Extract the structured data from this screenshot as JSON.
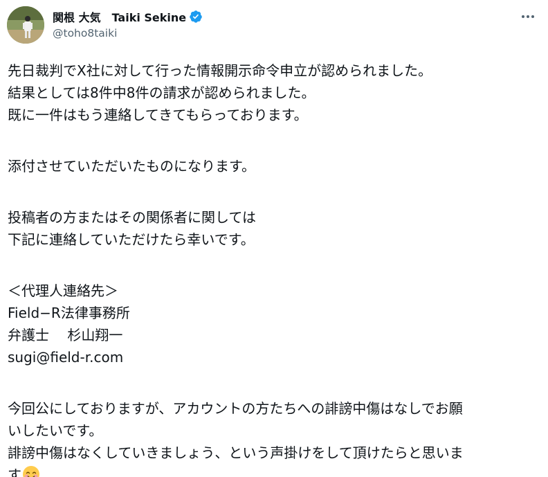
{
  "author": {
    "display_name": "関根 大気　Taiki Sekine",
    "handle": "@toho8taiki",
    "verified": true,
    "verified_color": "#1d9bf0"
  },
  "icons": {
    "verified": "verified-badge-icon",
    "more": "more-options-icon",
    "emoji": "smiling-face-emoji"
  },
  "tweet": {
    "paragraphs": [
      [
        "先日裁判でX社に対して行った情報開示命令申立が認められました。",
        "結果としては8件中8件の請求が認められました。",
        "既に一件はもう連絡してきてもらっております。"
      ],
      [
        "添付させていただいたものになります。"
      ],
      [
        "投稿者の方またはその関係者に関しては",
        "下記に連絡していただけたら幸いです。"
      ],
      [
        "＜代理人連絡先＞",
        "Field−R法律事務所",
        "弁護士　 杉山翔一",
        "sugi@field-r.com"
      ],
      [
        "今回公にしておりますが、アカウントの方たちへの誹謗中傷はなしでお願",
        "いしたいです。",
        "誹謗中傷はなくしていきましょう、という声掛けをして頂けたらと思いま",
        "す"
      ]
    ]
  }
}
